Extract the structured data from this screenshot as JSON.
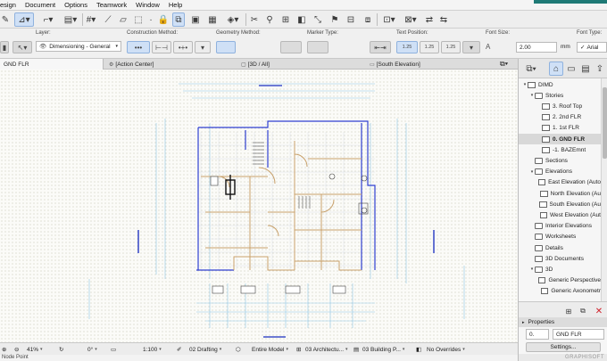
{
  "menu": {
    "items": [
      "esign",
      "Document",
      "Options",
      "Teamwork",
      "Window",
      "Help"
    ]
  },
  "info_box": {
    "layer_label": "Layer:",
    "layer_value": "Dimensioning - General",
    "construction_method_label": "Construction Method:",
    "geometry_method_label": "Geometry Method:",
    "marker_type_label": "Marker Type:",
    "text_position_label": "Text Position:",
    "text_position_values": [
      "1.25",
      "1.25",
      "1.25"
    ],
    "font_size_label": "Font Size:",
    "font_size_value": "2.00",
    "font_size_unit": "mm",
    "font_type_label": "Font Type:",
    "font_type_value": "Arial"
  },
  "tabs": [
    {
      "label": "GND FLR"
    },
    {
      "label": "[Action Center]"
    },
    {
      "label": "[3D / All]"
    },
    {
      "label": "[South Elevation]"
    }
  ],
  "statusbar": {
    "zoom": "41%",
    "angle": "0°",
    "scale": "1:100",
    "pen_set": "02 Drafting",
    "model_view": "Entire Model",
    "layer_combo": "03 Architectu...",
    "building_plan": "03 Building P...",
    "overrides": "No Overrides"
  },
  "hint": "Node Point",
  "navigator": {
    "tree": [
      {
        "label": "DIMD",
        "level": 0,
        "arrow": "▾",
        "type": "project"
      },
      {
        "label": "Stories",
        "level": 1,
        "arrow": "▾",
        "type": "folder"
      },
      {
        "label": "3. Roof Top",
        "level": 2,
        "arrow": "",
        "type": "story"
      },
      {
        "label": "2. 2nd FLR",
        "level": 2,
        "arrow": "",
        "type": "story"
      },
      {
        "label": "1. 1st FLR",
        "level": 2,
        "arrow": "",
        "type": "story"
      },
      {
        "label": "0. GND FLR",
        "level": 2,
        "arrow": "",
        "type": "story",
        "selected": true
      },
      {
        "label": "-1. BAZEmnt",
        "level": 2,
        "arrow": "",
        "type": "story"
      },
      {
        "label": "Sections",
        "level": 1,
        "arrow": "",
        "type": "folder"
      },
      {
        "label": "Elevations",
        "level": 1,
        "arrow": "▾",
        "type": "folder"
      },
      {
        "label": "East Elevation (Auto",
        "level": 2,
        "arrow": "",
        "type": "view"
      },
      {
        "label": "North Elevation (Au",
        "level": 2,
        "arrow": "",
        "type": "view"
      },
      {
        "label": "South Elevation (Au",
        "level": 2,
        "arrow": "",
        "type": "view"
      },
      {
        "label": "West Elevation (Aut",
        "level": 2,
        "arrow": "",
        "type": "view"
      },
      {
        "label": "Interior Elevations",
        "level": 1,
        "arrow": "",
        "type": "folder"
      },
      {
        "label": "Worksheets",
        "level": 1,
        "arrow": "",
        "type": "folder"
      },
      {
        "label": "Details",
        "level": 1,
        "arrow": "",
        "type": "folder"
      },
      {
        "label": "3D Documents",
        "level": 1,
        "arrow": "",
        "type": "folder"
      },
      {
        "label": "3D",
        "level": 1,
        "arrow": "▾",
        "type": "folder"
      },
      {
        "label": "Generic Perspective",
        "level": 2,
        "arrow": "",
        "type": "view"
      },
      {
        "label": "Generic Axonometr",
        "level": 2,
        "arrow": "",
        "type": "view"
      }
    ],
    "properties_label": "Properties",
    "properties_id": "0.",
    "properties_name": "GND FLR",
    "settings_label": "Settings...",
    "brand": "GRAPHISOFT"
  },
  "colors": {
    "selection": "#cfe0f6",
    "teal_accent": "#1f7a76",
    "wall_blue": "#2f3fd0",
    "plan_brown": "#c8a06a",
    "dim_cyan": "#8fc7e6"
  }
}
